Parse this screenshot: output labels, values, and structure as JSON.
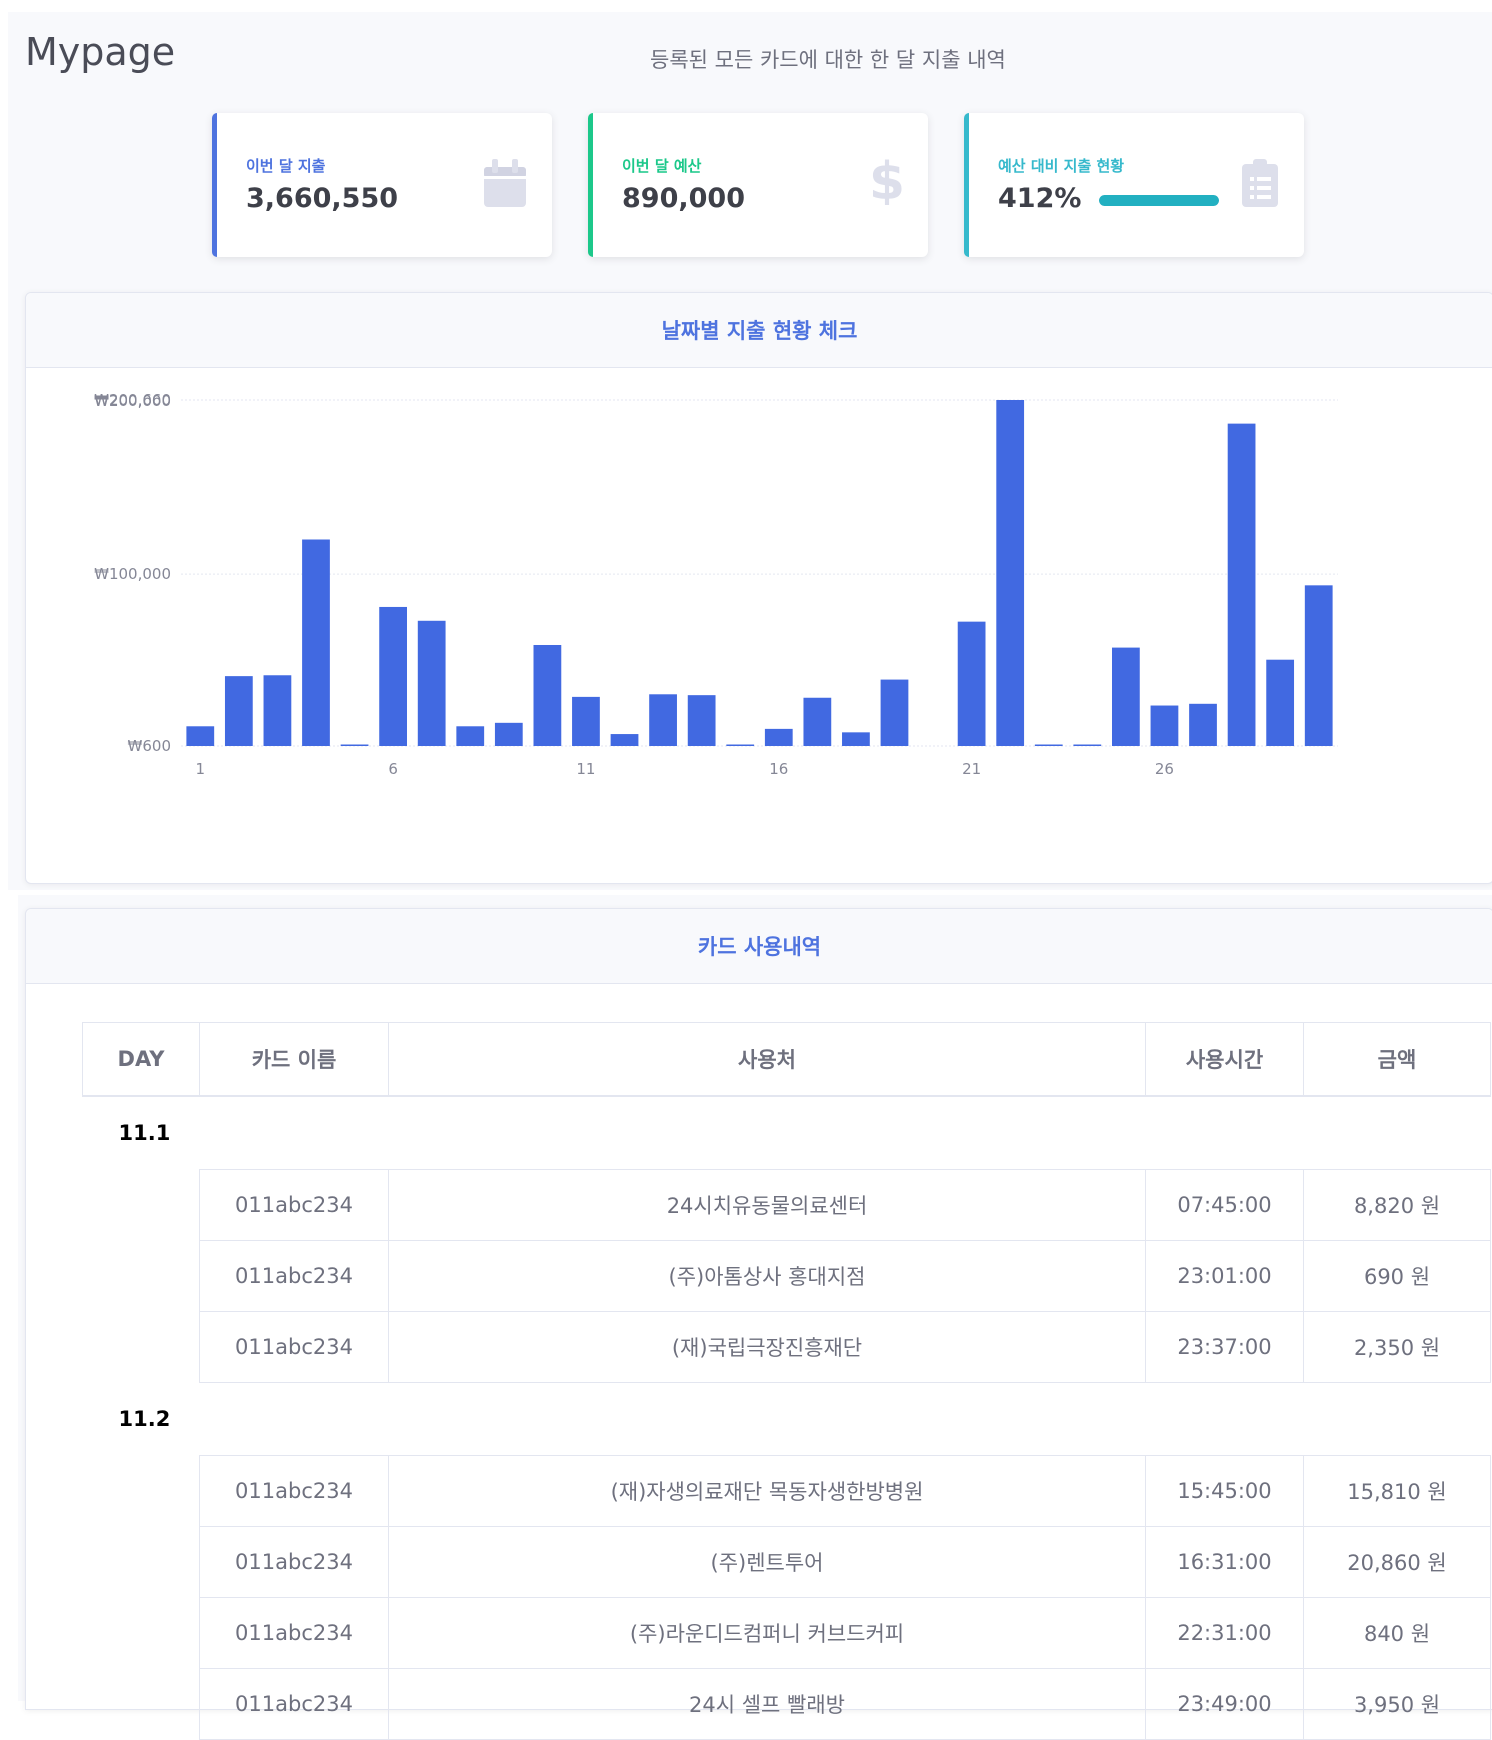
{
  "page": {
    "title": "Mypage",
    "subtitle": "등록된 모든 카드에 대한 한 달 지출 내역"
  },
  "cards": [
    {
      "label": "이번 달 지출",
      "value": "3,660,550",
      "icon": "calendar-icon",
      "color": "#4e73df"
    },
    {
      "label": "이번 달 예산",
      "value": "890,000",
      "icon": "dollar-icon",
      "color": "#1cc88a"
    },
    {
      "label": "예산 대비 지출 현황",
      "value": "412%",
      "icon": "clipboard-icon",
      "color": "#36b9cc",
      "progress_percent": 100
    }
  ],
  "chart_panel": {
    "title": "날짜별 지출 현황 체크"
  },
  "chart_data": {
    "type": "bar",
    "categories": [
      "1",
      "2",
      "3",
      "4",
      "5",
      "6",
      "7",
      "8",
      "9",
      "10",
      "11",
      "12",
      "13",
      "14",
      "15",
      "16",
      "17",
      "18",
      "19",
      "20",
      "21",
      "22",
      "23",
      "24",
      "25",
      "26",
      "27",
      "28",
      "29",
      "30"
    ],
    "values": [
      12000,
      41000,
      41500,
      120000,
      1000,
      81000,
      73000,
      12000,
      14000,
      59000,
      29000,
      7500,
      30500,
      30000,
      1200,
      10500,
      28500,
      8500,
      39000,
      0,
      72500,
      200660,
      1000,
      1000,
      57500,
      24000,
      25000,
      187000,
      50500,
      93500
    ],
    "ytick_labels": [
      "₩600",
      "₩100,000",
      "₩200,000",
      "₩200,660"
    ],
    "xtick_labels": [
      "1",
      "6",
      "11",
      "16",
      "21",
      "26"
    ],
    "ylim": [
      600,
      200660
    ],
    "bar_color": "#4169e1",
    "grid": true
  },
  "table_panel": {
    "title": "카드 사용내역"
  },
  "table": {
    "headers": [
      "DAY",
      "카드 이름",
      "사용처",
      "사용시간",
      "금액"
    ],
    "groups": [
      {
        "day": "11.1",
        "rows": [
          {
            "card": "011abc234",
            "merchant": "24시치유동물의료센터",
            "time": "07:45:00",
            "amount": "8,820 원"
          },
          {
            "card": "011abc234",
            "merchant": "(주)아톰상사 홍대지점",
            "time": "23:01:00",
            "amount": "690 원"
          },
          {
            "card": "011abc234",
            "merchant": "(재)국립극장진흥재단",
            "time": "23:37:00",
            "amount": "2,350 원"
          }
        ]
      },
      {
        "day": "11.2",
        "rows": [
          {
            "card": "011abc234",
            "merchant": "(재)자생의료재단 목동자생한방병원",
            "time": "15:45:00",
            "amount": "15,810 원"
          },
          {
            "card": "011abc234",
            "merchant": "(주)렌트투어",
            "time": "16:31:00",
            "amount": "20,860 원"
          },
          {
            "card": "011abc234",
            "merchant": "(주)라운디드컴퍼니 커브드커피",
            "time": "22:31:00",
            "amount": "840 원"
          },
          {
            "card": "011abc234",
            "merchant": "24시 셀프 빨래방",
            "time": "23:49:00",
            "amount": "3,950 원"
          }
        ]
      }
    ]
  }
}
